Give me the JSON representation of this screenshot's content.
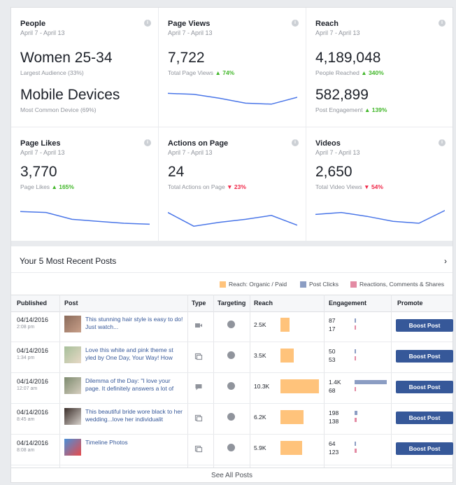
{
  "cards": [
    {
      "title": "People",
      "date": "April 7 - April 13",
      "value1": "Women 25-34",
      "sub1": "Largest Audience (33%)",
      "value2": "Mobile Devices",
      "sub2": "Most Common Device (69%)"
    },
    {
      "title": "Page Views",
      "date": "April 7 - April 13",
      "value": "7,722",
      "sub": "Total Page Views",
      "change": "▲ 74%",
      "trend": "up",
      "spark": [
        0.3,
        0.35,
        0.55,
        0.8,
        0.85,
        0.5
      ]
    },
    {
      "title": "Reach",
      "date": "April 7 - April 13",
      "value": "4,189,048",
      "sub": "People Reached",
      "change": "▲ 340%",
      "trend": "up",
      "value2": "582,899",
      "sub2": "Post Engagement",
      "change2": "▲ 139%"
    },
    {
      "title": "Page Likes",
      "date": "April 7 - April 13",
      "value": "3,770",
      "sub": "Page Likes",
      "change": "▲ 165%",
      "trend": "up",
      "spark": [
        0.15,
        0.2,
        0.55,
        0.65,
        0.75,
        0.8
      ]
    },
    {
      "title": "Actions on Page",
      "date": "April 7 - April 13",
      "value": "24",
      "sub": "Total Actions on Page",
      "change": "▼ 23%",
      "trend": "down",
      "spark": [
        0.2,
        0.9,
        0.7,
        0.55,
        0.35,
        0.85
      ]
    },
    {
      "title": "Videos",
      "date": "April 7 - April 13",
      "value": "2,650",
      "sub": "Total Video Views",
      "change": "▼ 54%",
      "trend": "down",
      "spark": [
        0.3,
        0.2,
        0.4,
        0.65,
        0.75,
        0.1
      ]
    }
  ],
  "posts_section": {
    "title": "Your 5 Most Recent Posts",
    "legend": [
      "Reach: Organic / Paid",
      "Post Clicks",
      "Reactions, Comments & Shares"
    ],
    "columns": [
      "Published",
      "Post",
      "Type",
      "Targeting",
      "Reach",
      "Engagement",
      "Promote"
    ],
    "rows": [
      {
        "date": "04/14/2016",
        "time": "2:08 pm",
        "text": "This stunning hair style is easy to do! Just watch...",
        "type": "video",
        "reach": "2.5K",
        "reach_frac": 0.24,
        "e1": "87",
        "e2": "17",
        "e1_frac": 0.02,
        "e2_frac": 0.02,
        "button": "Boost Post"
      },
      {
        "date": "04/14/2016",
        "time": "1:34 pm",
        "text": "Love this white and pink theme st yled by One Day, Your Way! How",
        "type": "photo",
        "reach": "3.5K",
        "reach_frac": 0.34,
        "e1": "50",
        "e2": "53",
        "e1_frac": 0.02,
        "e2_frac": 0.02,
        "button": "Boost Post"
      },
      {
        "date": "04/14/2016",
        "time": "12:07 am",
        "text": "Dilemma of the Day: \"I love your page. It definitely answers a lot of",
        "type": "status",
        "reach": "10.3K",
        "reach_frac": 1.0,
        "e1": "1.4K",
        "e2": "68",
        "e1_frac": 0.83,
        "e2_frac": 0.02,
        "button": "Boost Post"
      },
      {
        "date": "04/14/2016",
        "time": "8:45 am",
        "text": "This beautiful bride wore black to her wedding...love her individualit",
        "type": "photo",
        "reach": "6.2K",
        "reach_frac": 0.6,
        "e1": "198",
        "e2": "138",
        "e1_frac": 0.08,
        "e2_frac": 0.06,
        "button": "Boost Post"
      },
      {
        "date": "04/14/2016",
        "time": "8:08 am",
        "text": "Timeline Photos",
        "type": "photo",
        "reach": "5.9K",
        "reach_frac": 0.57,
        "e1": "64",
        "e2": "123",
        "e1_frac": 0.02,
        "e2_frac": 0.05,
        "button": "Boost Post"
      }
    ],
    "see_all": "See All Posts"
  },
  "colors": {
    "reach": "#ffc37b",
    "clicks": "#8b9dc3",
    "reactions": "#e38aa3",
    "spark": "#4a76e8",
    "boost": "#365899"
  }
}
